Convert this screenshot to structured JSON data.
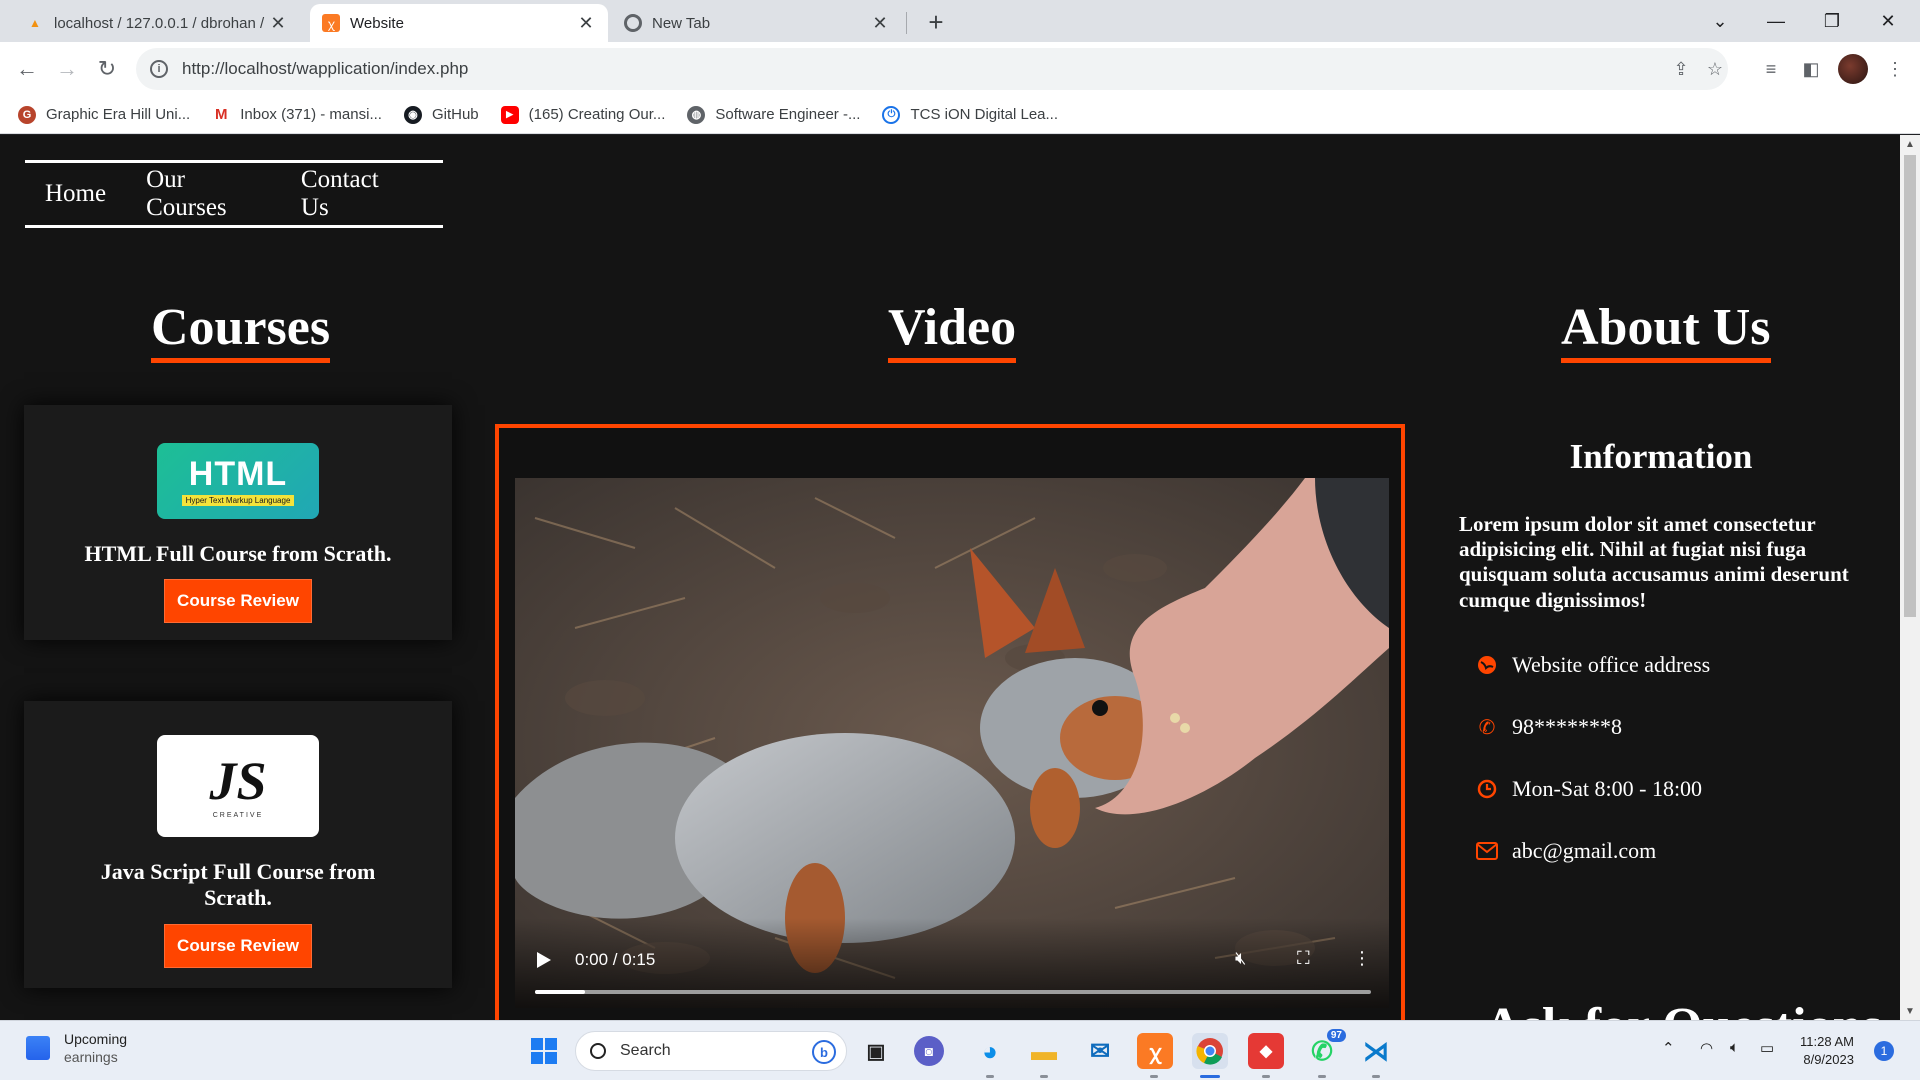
{
  "browser": {
    "tabs": [
      {
        "title": "localhost / 127.0.0.1 / dbrohan /",
        "icon": "phpmyadmin-icon",
        "active": false
      },
      {
        "title": "Website",
        "icon": "xampp-icon",
        "active": true
      },
      {
        "title": "New Tab",
        "icon": "chrome-icon",
        "active": false
      }
    ],
    "url": "http://localhost/wapplication/index.php",
    "bookmarks": [
      {
        "label": "Graphic Era Hill Uni...",
        "icon": "graphic-era-icon",
        "color": "#b8442c"
      },
      {
        "label": "Inbox (371) - mansi...",
        "icon": "gmail-icon",
        "color": "#d93025"
      },
      {
        "label": "GitHub",
        "icon": "github-icon",
        "color": "#161b22"
      },
      {
        "label": "(165) Creating Our...",
        "icon": "youtube-icon",
        "color": "#ff0000"
      },
      {
        "label": "Software Engineer -...",
        "icon": "globe-icon",
        "color": "#5f6368"
      },
      {
        "label": "TCS iON Digital Lea...",
        "icon": "tcs-power-icon",
        "color": "#1a73e8"
      }
    ]
  },
  "page": {
    "accent": "#ff4500",
    "nav": [
      "Home",
      "Our Courses",
      "Contact Us"
    ],
    "headings": {
      "courses": "Courses",
      "video": "Video",
      "about": "About Us"
    },
    "courses": [
      {
        "logo_main": "HTML",
        "logo_sub": "Hyper Text Markup Language",
        "title": "HTML Full Course from Scrath.",
        "button": "Course Review"
      },
      {
        "logo_main": "JS",
        "logo_sub": "CREATIVE",
        "title": "Java Script Full Course from Scrath.",
        "button": "Course Review"
      }
    ],
    "video": {
      "time": "0:00 / 0:15",
      "progress": 0.06
    },
    "about": {
      "info_title": "Information",
      "info_text": "Lorem ipsum dolor sit amet consectetur adipisicing elit. Nihil at fugiat nisi fuga quisquam soluta accusamus animi deserunt cumque dignissimos!",
      "contacts": [
        {
          "icon": "globe-icon",
          "text": "Website office address"
        },
        {
          "icon": "phone-icon",
          "text": "98*******8"
        },
        {
          "icon": "clock-icon",
          "text": "Mon-Sat 8:00 - 18:00"
        },
        {
          "icon": "envelope-icon",
          "text": "abc@gmail.com"
        }
      ],
      "partial_heading": "Ask for Questions"
    }
  },
  "taskbar": {
    "weather_title": "Upcoming",
    "weather_sub": "earnings",
    "search_placeholder": "Search",
    "whatsapp_badge": "97",
    "time": "11:28 AM",
    "date": "8/9/2023",
    "notification_count": "1"
  }
}
